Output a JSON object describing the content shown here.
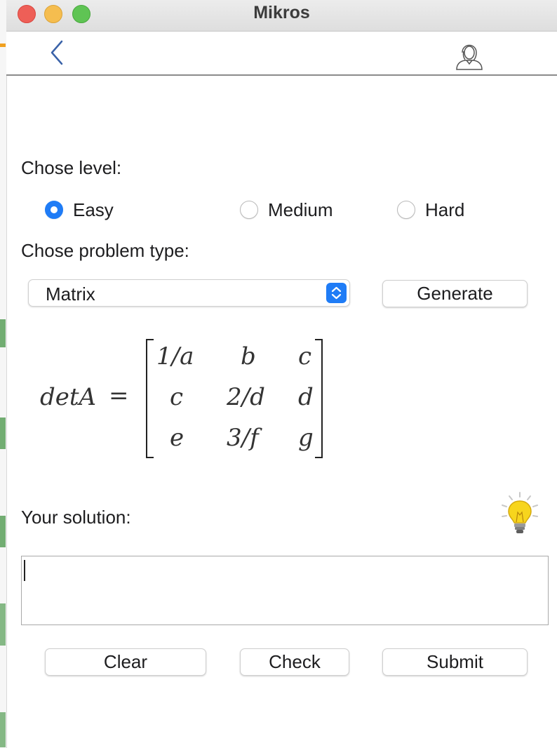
{
  "window": {
    "title": "Mikros"
  },
  "nav": {
    "back_icon": "chevron-left-icon",
    "profile_icon": "user-profile-icon"
  },
  "level": {
    "label": "Chose level:",
    "options": [
      "Easy",
      "Medium",
      "Hard"
    ],
    "selected": "Easy"
  },
  "problem_type": {
    "label": "Chose problem type:",
    "selected": "Matrix"
  },
  "generate_label": "Generate",
  "problem": {
    "lhs": "detA",
    "equals": "=",
    "matrix": [
      [
        "1/a",
        "b",
        "c"
      ],
      [
        "c",
        "2/d",
        "d"
      ],
      [
        "e",
        "3/f",
        "g"
      ]
    ]
  },
  "solution": {
    "label": "Your solution:",
    "value": ""
  },
  "hint_icon": "lightbulb-icon",
  "actions": {
    "clear": "Clear",
    "check": "Check",
    "submit": "Submit"
  },
  "colors": {
    "accent": "#1f7cf6",
    "close": "#ee5f57",
    "minimize": "#f5bd4f",
    "maximize": "#5fc454",
    "bulb": "#f7d51d"
  }
}
